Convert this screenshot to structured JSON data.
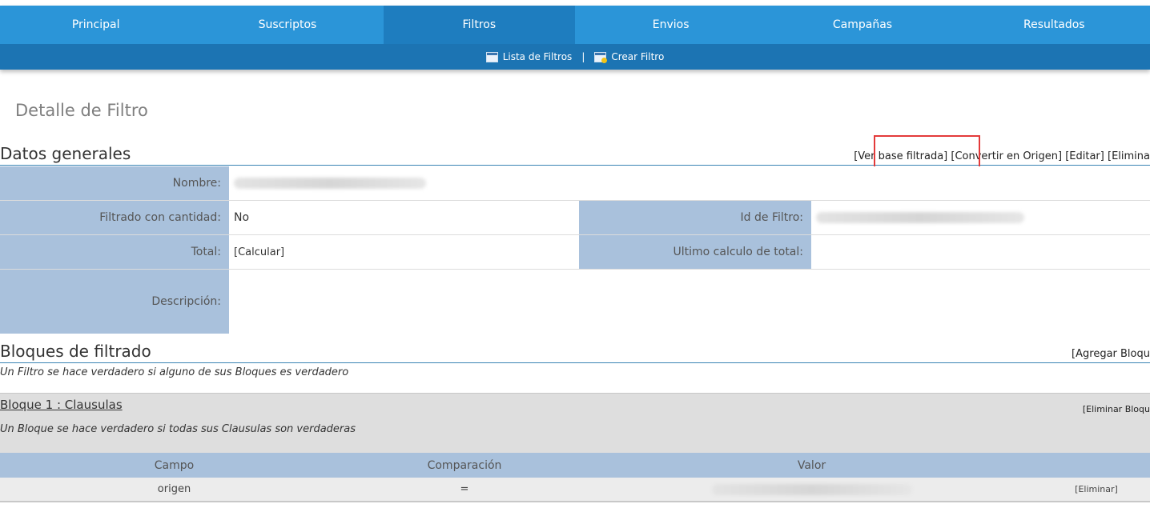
{
  "nav": {
    "tabs": [
      {
        "label": "Principal"
      },
      {
        "label": "Suscriptos"
      },
      {
        "label": "Filtros"
      },
      {
        "label": "Envios"
      },
      {
        "label": "Campañas"
      },
      {
        "label": "Resultados"
      }
    ],
    "active_tab": "Filtros",
    "sub": {
      "list_label": "Lista de Filtros",
      "separator": "|",
      "create_label": "Crear Filtro"
    }
  },
  "page": {
    "title": "Detalle de Filtro"
  },
  "general": {
    "heading": "Datos generales",
    "actions": {
      "view": "[Ver base filtrada]",
      "convert": "[Convertir en Origen]",
      "edit": "[Editar]",
      "delete": "[Elimina"
    },
    "fields": {
      "nombre_label": "Nombre:",
      "cantidad_label": "Filtrado con cantidad:",
      "cantidad_value": "No",
      "id_label": "Id de Filtro:",
      "total_label": "Total:",
      "total_value": "[Calcular]",
      "ultimo_label": "Ultimo calculo de total:",
      "descripcion_label": "Descripción:"
    }
  },
  "blocks": {
    "heading": "Bloques de filtrado",
    "add_action": "[Agregar Bloqu",
    "note": "Un Filtro se hace verdadero si alguno de sus Bloques es verdadero",
    "block1": {
      "title": "Bloque 1 : Clausulas",
      "delete": "[Eliminar Bloqu",
      "note": "Un Bloque se hace verdadero si todas sus Clausulas son verdaderas",
      "columns": [
        "Campo",
        "Comparación",
        "Valor"
      ],
      "rows": [
        {
          "campo": "origen",
          "comparacion": "=",
          "action": "[Eliminar]"
        }
      ]
    }
  },
  "colors": {
    "nav": "#2b95d8",
    "nav_active": "#1e7dbf",
    "subnav": "#1c74b3",
    "label_bg": "#a9c1dc",
    "highlight": "#e33a3a"
  }
}
